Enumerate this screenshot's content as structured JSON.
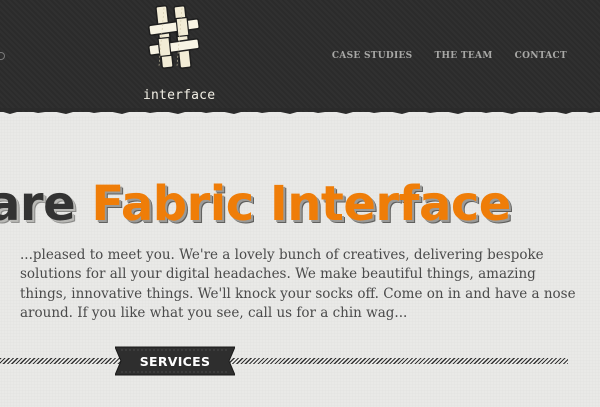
{
  "header": {
    "nav": [
      {
        "label": "CASE STUDIES"
      },
      {
        "label": "THE TEAM"
      },
      {
        "label": "CONTACT"
      }
    ],
    "logo_text": "interface",
    "logo_icon": "woven-hash-icon"
  },
  "hero": {
    "headline_prefix": "are",
    "headline_accent": "Fabric Interface",
    "intro": "...pleased to meet you. We're a lovely bunch of creatives, delivering bespoke solutions for all your digital headaches. We make beautiful things, amazing things, innovative things. We'll knock your socks off. Come on in and have a nose around. If you like what you see, call us for a chin wag..."
  },
  "services": {
    "label": "SERVICES"
  },
  "colors": {
    "header_bg": "#2b2b2b",
    "accent": "#ef7d08",
    "paper": "#e9e9e7",
    "text": "#4a4a4a"
  }
}
